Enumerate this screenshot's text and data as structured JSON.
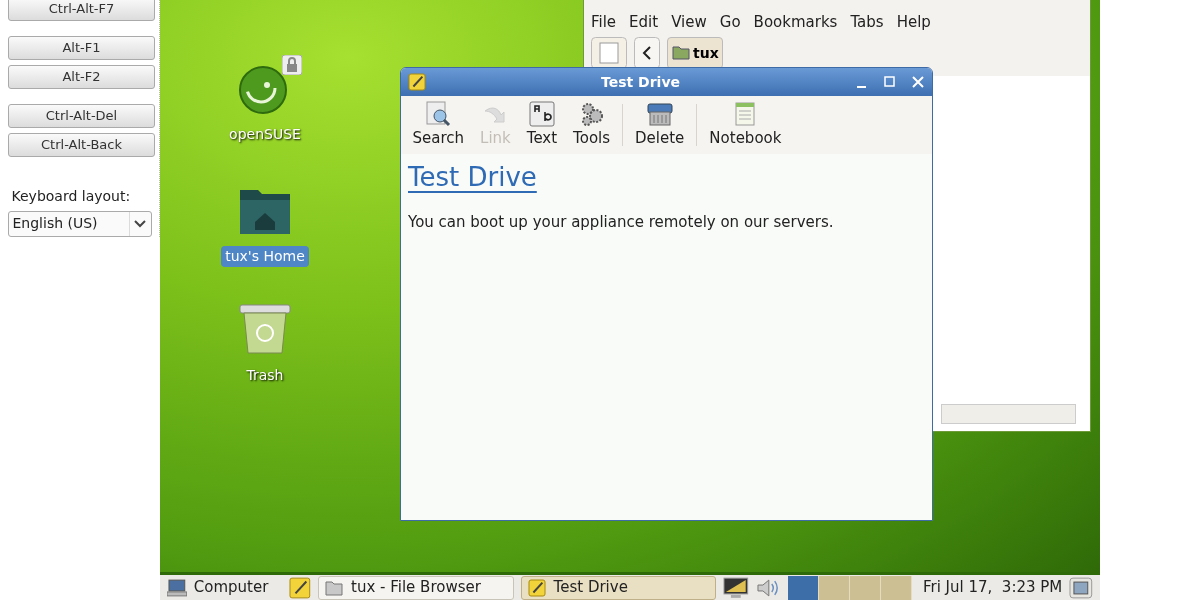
{
  "sidebar": {
    "button_groups": [
      [
        "Ctrl-Alt-F7"
      ],
      [
        "Alt-F1",
        "Alt-F2"
      ],
      [
        "Ctrl-Alt-Del",
        "Ctrl-Alt-Back"
      ]
    ],
    "keyboard_layout": {
      "label": "Keyboard layout:",
      "value": "English (US)"
    }
  },
  "desktop": {
    "icons": [
      {
        "kind": "opensuse",
        "label": "openSUSE",
        "locked": true,
        "selected": false
      },
      {
        "kind": "home",
        "label": "tux's Home",
        "locked": false,
        "selected": true
      },
      {
        "kind": "trash",
        "label": "Trash",
        "locked": false,
        "selected": false
      }
    ]
  },
  "file_browser": {
    "menu": [
      "File",
      "Edit",
      "View",
      "Go",
      "Bookmarks",
      "Tabs",
      "Help"
    ],
    "path_button": "tux"
  },
  "note_window": {
    "title": "Test Drive",
    "toolbar": [
      {
        "kind": "search",
        "label": "Search",
        "disabled": false
      },
      {
        "kind": "link",
        "label": "Link",
        "disabled": true
      },
      {
        "kind": "text",
        "label": "Text",
        "disabled": false
      },
      {
        "kind": "tools",
        "label": "Tools",
        "disabled": false
      },
      {
        "kind": "separator"
      },
      {
        "kind": "delete",
        "label": "Delete",
        "disabled": false
      },
      {
        "kind": "separator"
      },
      {
        "kind": "notebook",
        "label": "Notebook",
        "disabled": false
      }
    ],
    "note_title": "Test Drive",
    "note_body": "You can boot up your appliance remotely on our servers."
  },
  "taskbar": {
    "launchers": [
      {
        "kind": "computer",
        "label": "Computer"
      },
      {
        "kind": "note"
      }
    ],
    "tasks": [
      {
        "kind": "folder",
        "label": "tux - File Browser",
        "selected": false
      },
      {
        "kind": "note",
        "label": "Test Drive",
        "selected": true
      }
    ],
    "workspaces": [
      {
        "selected": true
      },
      {
        "selected": false
      },
      {
        "selected": false
      },
      {
        "selected": false
      }
    ],
    "clock": "Fri Jul 17,  3:23 PM"
  }
}
